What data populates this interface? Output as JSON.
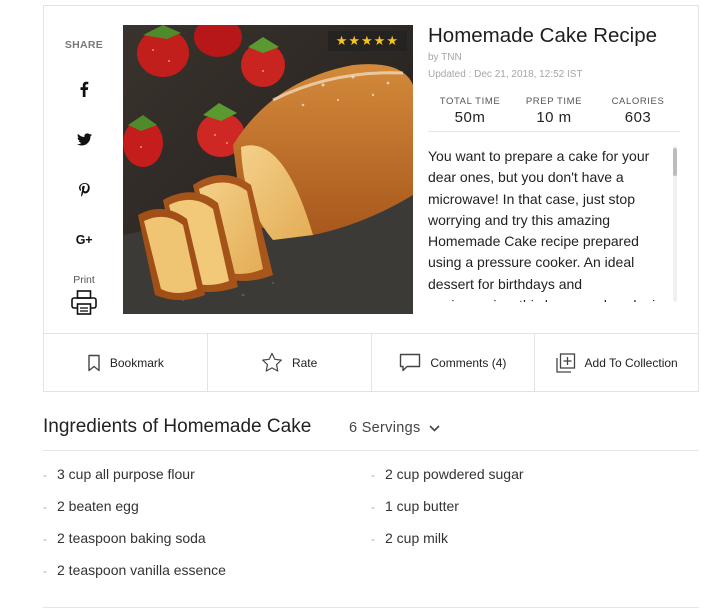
{
  "share": {
    "label": "SHARE",
    "print_label": "Print"
  },
  "recipe": {
    "title": "Homemade Cake Recipe",
    "byline": "by TNN",
    "updated": "Updated : Dec 21, 2018, 12:52 IST",
    "rating_stars": "★★★★★",
    "rating_value": 5,
    "stats": [
      {
        "label": "TOTAL TIME",
        "value": "50m"
      },
      {
        "label": "PREP TIME",
        "value": "10 m"
      },
      {
        "label": "CALORIES",
        "value": "603"
      }
    ],
    "description": "You want to prepare a cake for your dear ones, but you don't have a microwave! In that case, just stop worrying and try this amazing Homemade Cake recipe prepared using a pressure cooker. An ideal dessert for birthdays and anniversaries, this homemade cake is"
  },
  "actions": {
    "bookmark": "Bookmark",
    "rate": "Rate",
    "comments": "Comments (4)",
    "add_to_collection": "Add To Collection"
  },
  "ingredients": {
    "title": "Ingredients of Homemade Cake",
    "servings": "6 Servings",
    "left": [
      "3 cup all purpose flour",
      "2 beaten egg",
      "2 teaspoon baking soda",
      "2 teaspoon vanilla essence"
    ],
    "right": [
      "2 cup powdered sugar",
      "1 cup butter",
      "2 cup milk"
    ]
  },
  "colors": {
    "star": "#f7c21b",
    "muted_text": "#a6a6a6",
    "border": "#e3e3e3"
  }
}
